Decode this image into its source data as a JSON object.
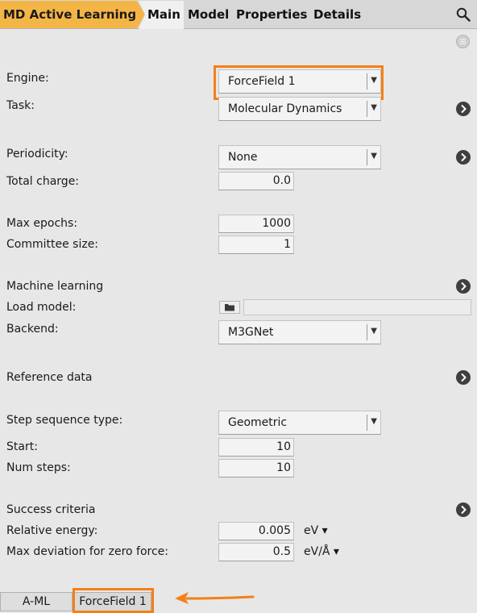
{
  "header": {
    "breadcrumb": "MD Active Learning",
    "tabs": [
      "Main",
      "Model",
      "Properties",
      "Details"
    ],
    "active_tab": "Main"
  },
  "icons": {
    "search": "search-icon",
    "menu": "menu-icon",
    "expand": "chevron-right-icon",
    "folder": "folder-icon"
  },
  "colors": {
    "breadcrumb": "#f4b547",
    "highlight": "#f57f17"
  },
  "form": {
    "engine": {
      "label": "Engine:",
      "value": "ForceField 1"
    },
    "task": {
      "label": "Task:",
      "value": "Molecular Dynamics"
    },
    "periodicity": {
      "label": "Periodicity:",
      "value": "None"
    },
    "total_charge": {
      "label": "Total charge:",
      "value": "0.0"
    },
    "max_epochs": {
      "label": "Max epochs:",
      "value": "1000"
    },
    "committee_size": {
      "label": "Committee size:",
      "value": "1"
    },
    "machine_learning": {
      "label": "Machine learning"
    },
    "load_model": {
      "label": "Load model:",
      "value": ""
    },
    "backend": {
      "label": "Backend:",
      "value": "M3GNet"
    },
    "reference_data": {
      "label": "Reference data"
    },
    "step_sequence": {
      "label": "Step sequence type:",
      "value": "Geometric"
    },
    "start": {
      "label": "Start:",
      "value": "10"
    },
    "num_steps": {
      "label": "Num steps:",
      "value": "10"
    },
    "success_criteria": {
      "label": "Success criteria"
    },
    "relative_energy": {
      "label": "Relative energy:",
      "value": "0.005",
      "unit": "eV ▾"
    },
    "max_deviation": {
      "label": "Max deviation for zero force:",
      "value": "0.5",
      "unit": "eV/Å ▾"
    }
  },
  "bottom_tabs": [
    "A-ML",
    "ForceField 1"
  ]
}
